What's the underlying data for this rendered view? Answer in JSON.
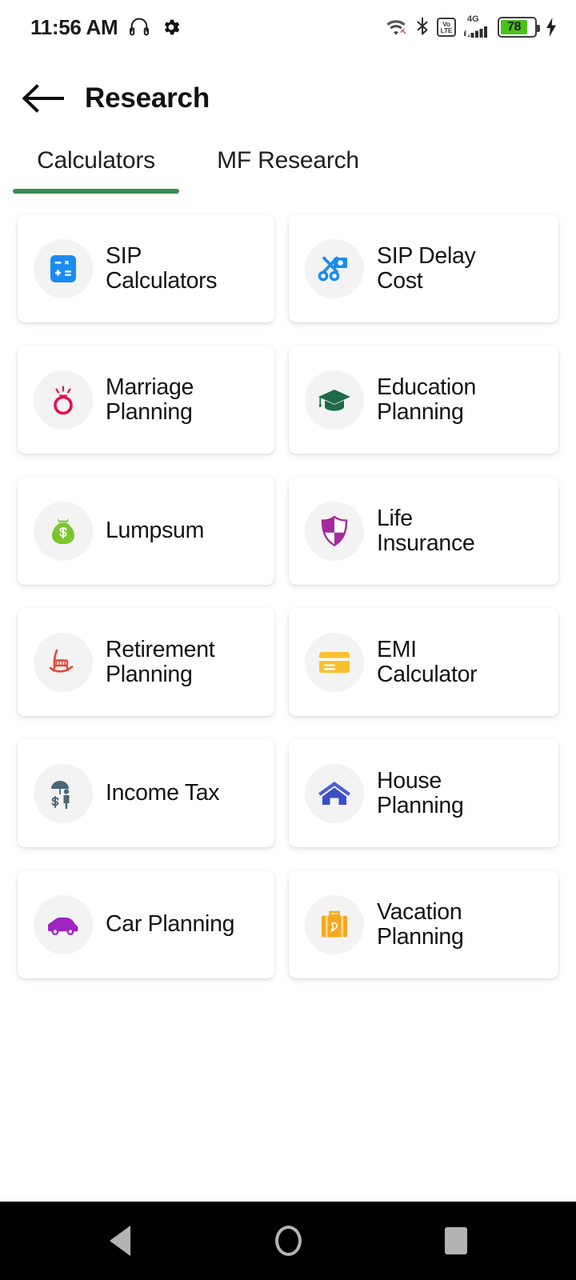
{
  "status_bar": {
    "time": "11:56 AM",
    "left_icons": [
      "headphone-icon",
      "gear-icon"
    ],
    "right_icons": [
      "wifi-icon",
      "bluetooth-icon",
      "volte-icon",
      "signal-icon",
      "battery-icon",
      "charging-icon"
    ],
    "network_label": "4G",
    "volte_top": "Vo",
    "volte_bottom": "LTE",
    "battery_percent": "78",
    "battery_color": "#4bc21a"
  },
  "header": {
    "back_icon": "arrow-left-icon",
    "title": "Research"
  },
  "tabs": {
    "active_index": 0,
    "active_color": "#3a8d52",
    "items": [
      {
        "label": "Calculators"
      },
      {
        "label": "MF Research"
      }
    ]
  },
  "grid": {
    "items": [
      {
        "label": "SIP\nCalculators",
        "icon": "calculator-icon",
        "color": "#1a8cf0"
      },
      {
        "label": "SIP Delay\nCost",
        "icon": "scissors-money-icon",
        "color": "#1a8cf0"
      },
      {
        "label": "Marriage\nPlanning",
        "icon": "ring-icon",
        "color": "#ea0b58"
      },
      {
        "label": "Education\nPlanning",
        "icon": "graduation-cap-icon",
        "color": "#1d6b47"
      },
      {
        "label": "Lumpsum",
        "icon": "money-bag-icon",
        "color": "#7ac62c"
      },
      {
        "label": "Life\nInsurance",
        "icon": "shield-icon",
        "color": "#a32a9e"
      },
      {
        "label": "Retirement\nPlanning",
        "icon": "rocking-chair-icon",
        "color": "#e04a3c"
      },
      {
        "label": "EMI\nCalculator",
        "icon": "credit-card-icon",
        "color": "#fbc02d"
      },
      {
        "label": "Income Tax",
        "icon": "umbrella-person-icon",
        "color": "#4a6576"
      },
      {
        "label": "House\nPlanning",
        "icon": "house-icon",
        "color": "#3a4fc4"
      },
      {
        "label": "Car Planning",
        "icon": "car-icon",
        "color": "#a024bf"
      },
      {
        "label": "Vacation\nPlanning",
        "icon": "suitcase-icon",
        "color": "#f5a91e"
      }
    ]
  },
  "navigation_bar": {
    "buttons": [
      "back-nav-button",
      "home-nav-button",
      "recents-nav-button"
    ]
  }
}
